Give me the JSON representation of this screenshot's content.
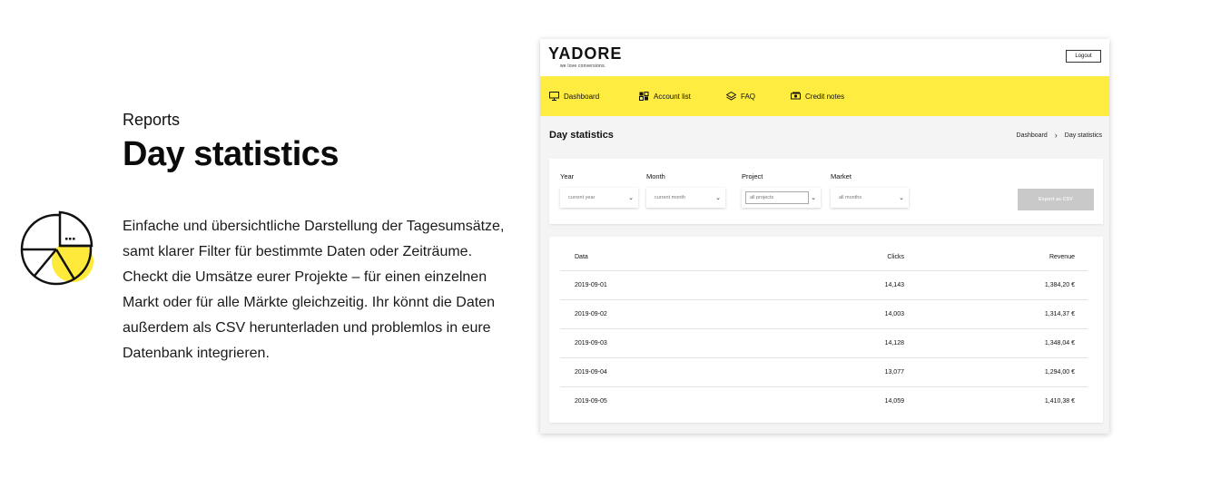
{
  "intro": {
    "eyebrow": "Reports",
    "headline": "Day statistics",
    "description": "Einfache und übersichtliche Darstellung der Tagesumsätze, samt klarer Filter für bestimmte Daten oder Zeiträume. Checkt die Umsätze eurer Projekte – für einen einzelnen Markt oder für alle Märkte gleichzeitig. Ihr könnt die Daten außerdem als CSV herunterladen und problemlos in eure Datenbank integrieren.",
    "illustration_icon": "pie-chart-icon",
    "accent_color": "#ffe93a"
  },
  "app": {
    "logo_text": "YADORE",
    "logo_tagline": "we love conversions.",
    "logout_label": "Logout",
    "nav": [
      {
        "label": "Dashboard",
        "icon": "monitor-icon"
      },
      {
        "label": "Account list",
        "icon": "accounts-icon"
      },
      {
        "label": "FAQ",
        "icon": "layers-icon"
      },
      {
        "label": "Credit notes",
        "icon": "money-icon"
      }
    ],
    "nav_color": "#ffec40",
    "page_title": "Day statistics",
    "breadcrumb": [
      "Dashboard",
      "Day statistics"
    ],
    "filters": [
      {
        "label": "Year",
        "value": "current year"
      },
      {
        "label": "Month",
        "value": "current month"
      },
      {
        "label": "Project",
        "value": "all projects"
      },
      {
        "label": "Market",
        "value": "all months"
      }
    ],
    "export_label": "Export as CSV",
    "table": {
      "headers": [
        "Data",
        "Clicks",
        "Revenue"
      ],
      "rows": [
        [
          "2019-09-01",
          "14,143",
          "1,384,20 €"
        ],
        [
          "2019-09-02",
          "14,003",
          "1,314,37 €"
        ],
        [
          "2019-09-03",
          "14,128",
          "1,348,04 €"
        ],
        [
          "2019-09-04",
          "13,077",
          "1,294,00 €"
        ],
        [
          "2019-09-05",
          "14,059",
          "1,410,38 €"
        ]
      ]
    }
  }
}
